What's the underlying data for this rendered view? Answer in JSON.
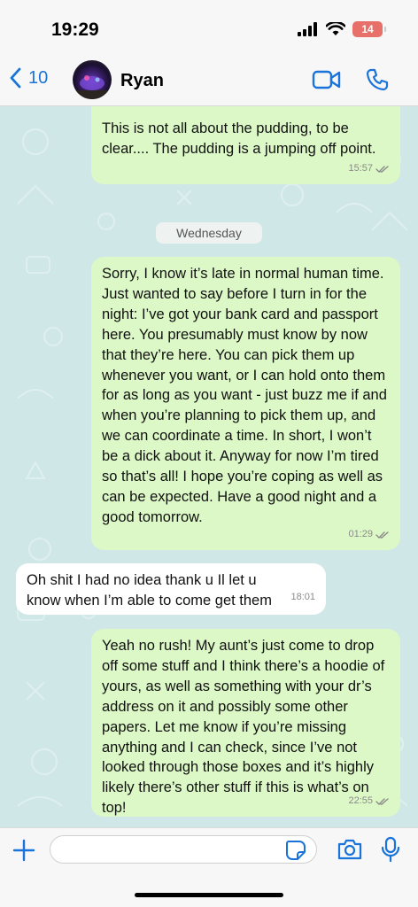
{
  "status": {
    "time": "19:29",
    "battery": "14"
  },
  "header": {
    "back_count": "10",
    "contact_name": "Ryan"
  },
  "day_separator": "Wednesday",
  "messages": [
    {
      "dir": "out",
      "text": "This is not all about the pudding, to be clear.... The pudding is a jumping off point.",
      "time": "15:57"
    },
    {
      "dir": "out",
      "text": "Sorry, I know it’s late in normal human time. Just wanted to say before I turn in for the night: I’ve got your bank card and passport here. You presumably must know by now that they’re here. You can pick them up whenever you want, or I can hold onto them for as long as you want - just buzz me if and when you’re planning to pick them up, and we can coordinate a time. In short, I won’t be a dick about it. Anyway for now I’m tired so that’s all! I hope you’re coping as well as can be expected. Have a good night and a good tomorrow.",
      "time": "01:29"
    },
    {
      "dir": "in",
      "text": "Oh shit I had no idea thank u Il let u know when I’m able to come get them",
      "time": "18:01"
    },
    {
      "dir": "out",
      "text": "Yeah no rush! My aunt’s just come to drop off some stuff and I think there’s a hoodie of yours, as well as something with your dr’s address on it and possibly some other papers. Let me know if you’re missing anything and I can check, since I’ve not looked through those boxes and it’s highly likely there’s other stuff if this is what’s on top!",
      "time": "22:55"
    }
  ],
  "composer": {
    "value": "",
    "placeholder": ""
  },
  "colors": {
    "accent": "#1a73d9",
    "outgoing_bubble": "#dcf8c6",
    "incoming_bubble": "#ffffff",
    "wallpaper": "#cfe7e7",
    "battery": "#e8706a"
  },
  "icons": [
    "back-chevron-icon",
    "video-call-icon",
    "phone-icon",
    "plus-icon",
    "sticker-icon",
    "camera-icon",
    "mic-icon",
    "read-receipt-icon"
  ]
}
